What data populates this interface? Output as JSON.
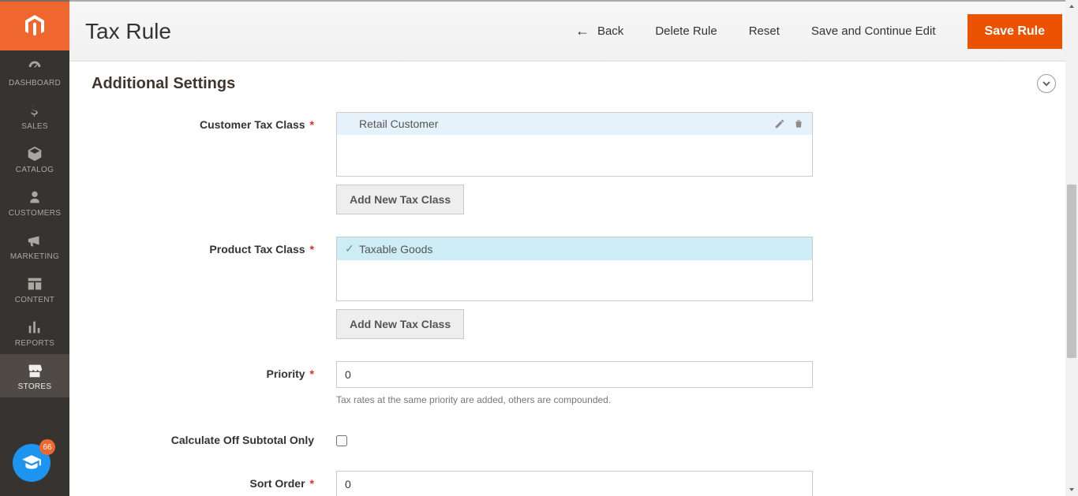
{
  "header": {
    "title": "Tax Rule",
    "back": "Back",
    "delete": "Delete Rule",
    "reset": "Reset",
    "save_continue": "Save and Continue Edit",
    "save": "Save Rule"
  },
  "sidebar": {
    "items": [
      {
        "label": "Dashboard"
      },
      {
        "label": "Sales"
      },
      {
        "label": "Catalog"
      },
      {
        "label": "Customers"
      },
      {
        "label": "Marketing"
      },
      {
        "label": "Content"
      },
      {
        "label": "Reports"
      },
      {
        "label": "Stores"
      }
    ]
  },
  "badge": {
    "count": "66"
  },
  "section": {
    "title": "Additional Settings"
  },
  "fields": {
    "customer_tax_class": {
      "label": "Customer Tax Class",
      "option": "Retail Customer",
      "add_btn": "Add New Tax Class"
    },
    "product_tax_class": {
      "label": "Product Tax Class",
      "option": "Taxable Goods",
      "add_btn": "Add New Tax Class"
    },
    "priority": {
      "label": "Priority",
      "value": "0",
      "hint": "Tax rates at the same priority are added, others are compounded."
    },
    "calc_off_subtotal": {
      "label": "Calculate Off Subtotal Only"
    },
    "sort_order": {
      "label": "Sort Order",
      "value": "0"
    }
  }
}
